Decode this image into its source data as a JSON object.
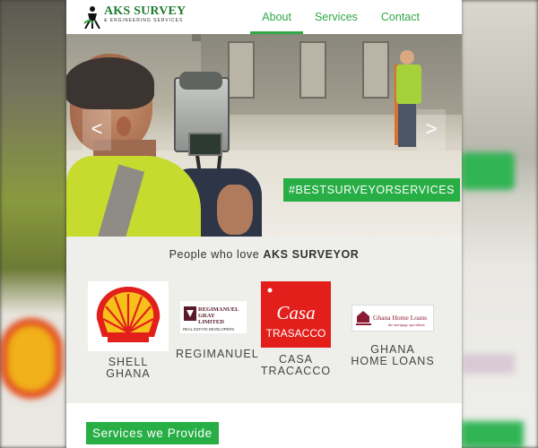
{
  "nav": {
    "logo_title": "AKS SURVEY",
    "logo_subtitle": "& ENGINEERING SERVICES",
    "links": [
      {
        "label": "About",
        "active": true
      },
      {
        "label": "Services",
        "active": false
      },
      {
        "label": "Contact",
        "active": false
      }
    ]
  },
  "hero": {
    "prev_label": "<",
    "next_label": ">",
    "hashtag": "#BESTSURVEYORSERVICES"
  },
  "clients": {
    "heading_prefix": "People who love ",
    "heading_brand": "AKS SURVEYOR",
    "items": [
      {
        "name_line1": "SHELL GHANA",
        "name_line2": ""
      },
      {
        "name_line1": "REGIMANUEL",
        "name_line2": "",
        "logo_line1": "REGIMANUEL",
        "logo_line2": "GRAY",
        "logo_line3": "LIMITED",
        "logo_tag": "REAL ESTATE DEVELOPERS"
      },
      {
        "name_line1": "CASA",
        "name_line2": "TRACACCO",
        "logo_line1": "Casa",
        "logo_line2": "TRASACCO"
      },
      {
        "name_line1": "GHANA",
        "name_line2": "HOME LOANS",
        "logo_line1": "Ghana Home Loans",
        "logo_tag": "the mortgage specialists"
      }
    ]
  },
  "services": {
    "button_label": "Services we Provide"
  },
  "colors": {
    "brand_green": "#27ae45",
    "shell_red": "#e31f1b",
    "shell_yellow": "#f6c21a"
  }
}
